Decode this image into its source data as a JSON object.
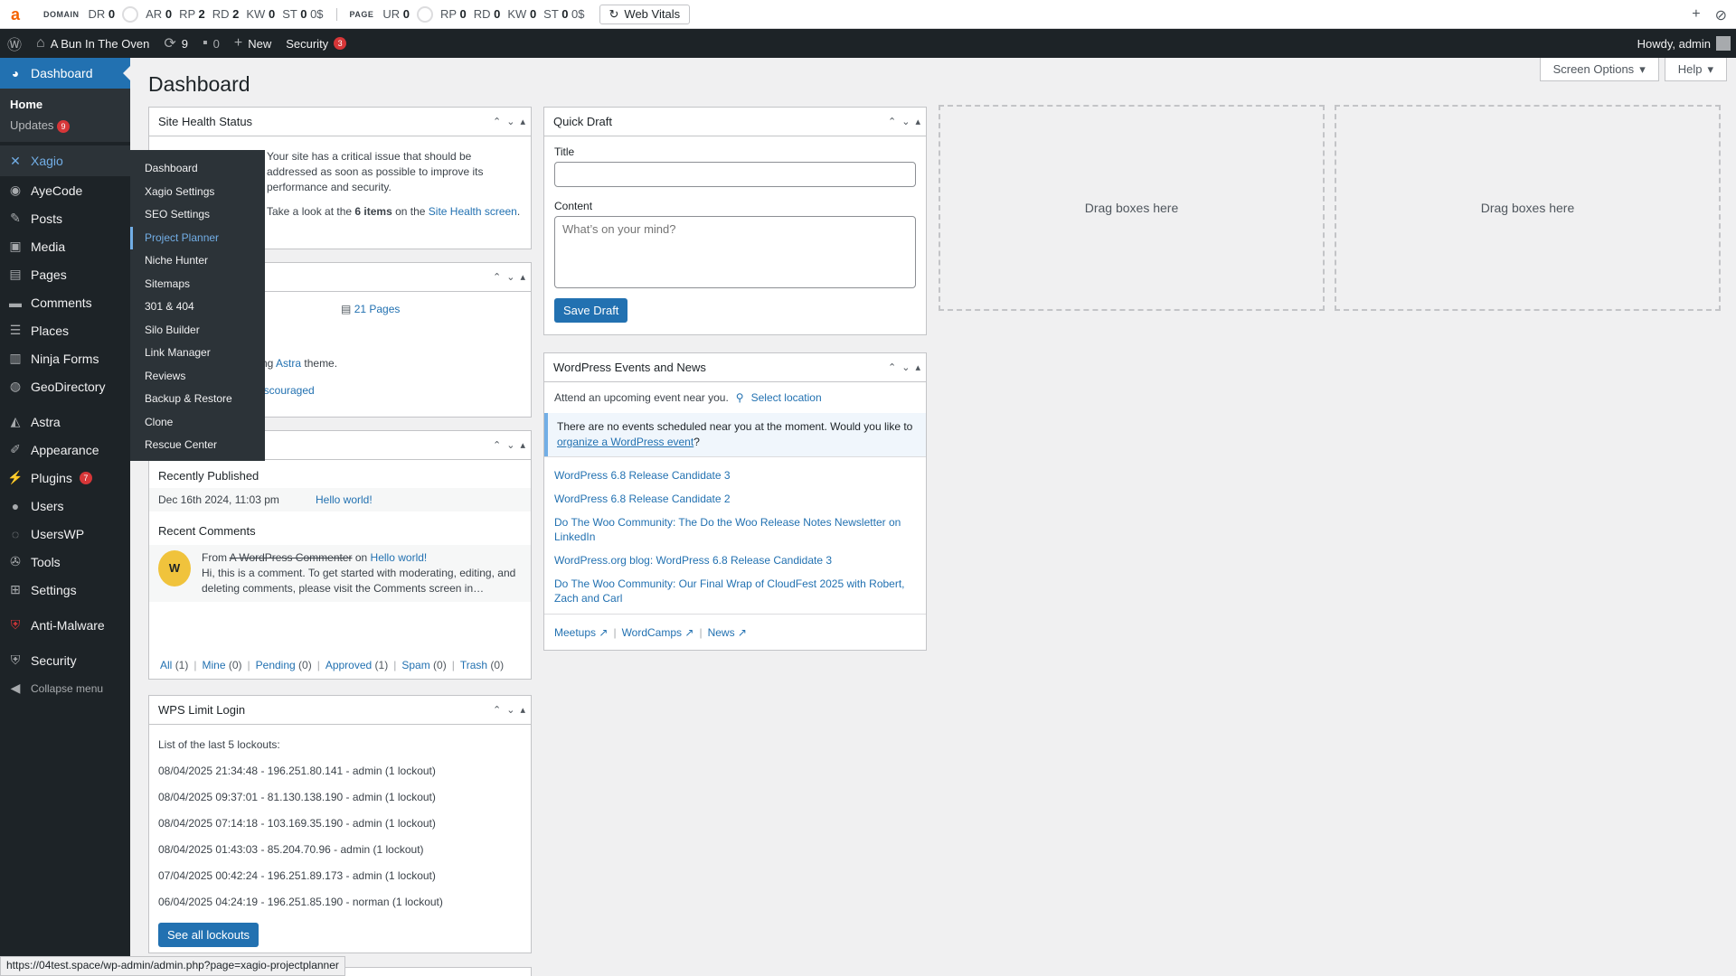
{
  "seo_bar": {
    "domain_label": "DOMAIN",
    "domain_metrics": [
      {
        "k": "DR",
        "v": "0"
      },
      {
        "k": "AR",
        "v": "0"
      },
      {
        "k": "RP",
        "v": "2"
      },
      {
        "k": "RD",
        "v": "2"
      },
      {
        "k": "KW",
        "v": "0"
      },
      {
        "k": "ST",
        "v": "0",
        "unit": "0$"
      }
    ],
    "page_label": "PAGE",
    "page_metrics": [
      {
        "k": "UR",
        "v": "0"
      },
      {
        "k": "RP",
        "v": "0"
      },
      {
        "k": "RD",
        "v": "0"
      },
      {
        "k": "KW",
        "v": "0"
      },
      {
        "k": "ST",
        "v": "0",
        "unit": "0$"
      }
    ],
    "web_vitals": "Web Vitals"
  },
  "admin_bar": {
    "site_name": "A Bun In The Oven",
    "updates_count": "9",
    "comments_count": "0",
    "new_label": "New",
    "security_label": "Security",
    "security_badge": "3",
    "howdy": "Howdy, admin"
  },
  "sidebar": {
    "dashboard": "Dashboard",
    "home": "Home",
    "updates": "Updates",
    "updates_badge": "9",
    "items": [
      {
        "label": "Xagio",
        "icon": "x-icon"
      },
      {
        "label": "AyeCode",
        "icon": "ayecode-icon"
      },
      {
        "label": "Posts",
        "icon": "pin-icon"
      },
      {
        "label": "Media",
        "icon": "media-icon"
      },
      {
        "label": "Pages",
        "icon": "page-icon"
      },
      {
        "label": "Comments",
        "icon": "comment-icon"
      },
      {
        "label": "Places",
        "icon": "list-icon"
      },
      {
        "label": "Ninja Forms",
        "icon": "form-icon"
      },
      {
        "label": "GeoDirectory",
        "icon": "globe-icon"
      },
      {
        "label": "Astra",
        "icon": "astra-icon"
      },
      {
        "label": "Appearance",
        "icon": "brush-icon"
      },
      {
        "label": "Plugins",
        "icon": "plug-icon",
        "badge": "7"
      },
      {
        "label": "Users",
        "icon": "user-icon"
      },
      {
        "label": "UsersWP",
        "icon": "userswp-icon"
      },
      {
        "label": "Tools",
        "icon": "wrench-icon"
      },
      {
        "label": "Settings",
        "icon": "settings-icon"
      },
      {
        "label": "Anti-Malware",
        "icon": "shield-red-icon"
      },
      {
        "label": "Security",
        "icon": "shield-icon"
      }
    ],
    "collapse": "Collapse menu"
  },
  "flyout": [
    "Dashboard",
    "Xagio Settings",
    "SEO Settings",
    "Project Planner",
    "Niche Hunter",
    "Sitemaps",
    "301 & 404",
    "Silo Builder",
    "Link Manager",
    "Reviews",
    "Backup & Restore",
    "Clone",
    "Rescue Center"
  ],
  "page": {
    "title": "Dashboard",
    "screen_options": "Screen Options",
    "help": "Help"
  },
  "site_health": {
    "title": "Site Health Status",
    "text1": "Your site has a critical issue that should be addressed as soon as possible to improve its performance and security.",
    "text2_pre": "Take a look at the ",
    "text2_bold": "6 items",
    "text2_mid": " on the ",
    "text2_link": "Site Health screen",
    "partial": "d"
  },
  "at_a_glance": {
    "pages": "21 Pages",
    "theme_pre": "ng ",
    "theme_link": "Astra",
    "theme_post": " theme.",
    "discouraged": "iscouraged"
  },
  "activity": {
    "recently_published": "Recently Published",
    "pub_date": "Dec 16th 2024, 11:03 pm",
    "pub_title": "Hello world!",
    "recent_comments": "Recent Comments",
    "comment_from": "From",
    "commenter": "A WordPress Commenter",
    "comment_on": "on",
    "comment_post": "Hello world!",
    "comment_text": "Hi, this is a comment. To get started with moderating, editing, and deleting comments, please visit the Comments screen in…",
    "filters": [
      {
        "label": "All",
        "count": "(1)"
      },
      {
        "label": "Mine",
        "count": "(0)"
      },
      {
        "label": "Pending",
        "count": "(0)"
      },
      {
        "label": "Approved",
        "count": "(1)"
      },
      {
        "label": "Spam",
        "count": "(0)"
      },
      {
        "label": "Trash",
        "count": "(0)"
      }
    ]
  },
  "wps_limit": {
    "title": "WPS Limit Login",
    "intro": "List of the last 5 lockouts:",
    "rows": [
      "08/04/2025 21:34:48 - 196.251.80.141 - admin (1 lockout)",
      "08/04/2025 09:37:01 - 81.130.138.190 - admin (1 lockout)",
      "08/04/2025 07:14:18 - 103.169.35.190 - admin (1 lockout)",
      "08/04/2025 01:43:03 - 85.204.70.96 - admin (1 lockout)",
      "07/04/2025 00:42:24 - 196.251.89.173 - admin (1 lockout)",
      "06/04/2025 04:24:19 - 196.251.85.190 - norman (1 lockout)"
    ],
    "button": "See all lockouts"
  },
  "quick_draft": {
    "title": "Quick Draft",
    "title_label": "Title",
    "content_label": "Content",
    "content_placeholder": "What’s on your mind?",
    "save": "Save Draft"
  },
  "events": {
    "title": "WordPress Events and News",
    "attend": "Attend an upcoming event near you.",
    "select_location": "Select location",
    "notice_pre": "There are no events scheduled near you at the moment. Would you like to ",
    "notice_link": "organize a WordPress event",
    "notice_post": "?",
    "news": [
      "WordPress 6.8 Release Candidate 3",
      "WordPress 6.8 Release Candidate 2",
      "Do The Woo Community: The Do the Woo Release Notes Newsletter on LinkedIn",
      "WordPress.org blog: WordPress 6.8 Release Candidate 3",
      "Do The Woo Community: Our Final Wrap of CloudFest 2025 with Robert, Zach and Carl"
    ],
    "footer": [
      "Meetups",
      "WordCamps",
      "News"
    ]
  },
  "dropzones": [
    "Drag boxes here",
    "Drag boxes here"
  ],
  "status_url": "https://04test.space/wp-admin/admin.php?page=xagio-projectplanner"
}
